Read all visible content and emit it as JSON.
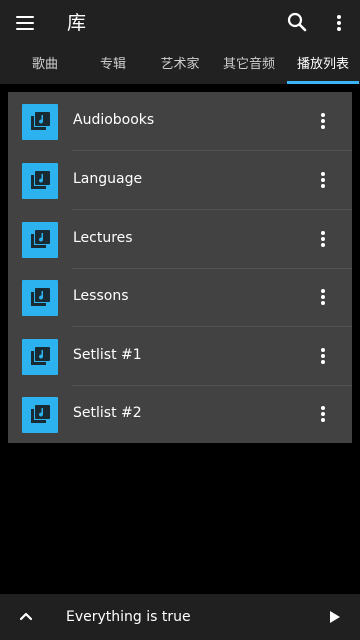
{
  "app": {
    "title": "库"
  },
  "toolbar": {
    "menu_icon": "hamburger-menu-icon",
    "search_icon": "search-icon",
    "more_icon": "more-vert-icon"
  },
  "tabs": [
    {
      "label": "歌曲",
      "active": false
    },
    {
      "label": "专辑",
      "active": false
    },
    {
      "label": "艺术家",
      "active": false
    },
    {
      "label": "其它音频",
      "active": false
    },
    {
      "label": "播放列表",
      "active": true
    }
  ],
  "colors": {
    "accent": "#3ab4f2",
    "appbar": "#212121",
    "card": "#424242",
    "thumb": "#2bb2ef",
    "background": "#000000"
  },
  "playlists": [
    {
      "label": "Audiobooks",
      "icon": "playlist-icon"
    },
    {
      "label": "Language",
      "icon": "playlist-icon"
    },
    {
      "label": "Lectures",
      "icon": "playlist-icon"
    },
    {
      "label": "Lessons",
      "icon": "playlist-icon"
    },
    {
      "label": "Setlist #1",
      "icon": "playlist-icon"
    },
    {
      "label": "Setlist #2",
      "icon": "playlist-icon"
    }
  ],
  "now_playing": {
    "title": "Everything is true",
    "expand_icon": "chevron-up-icon",
    "play_icon": "play-icon"
  }
}
